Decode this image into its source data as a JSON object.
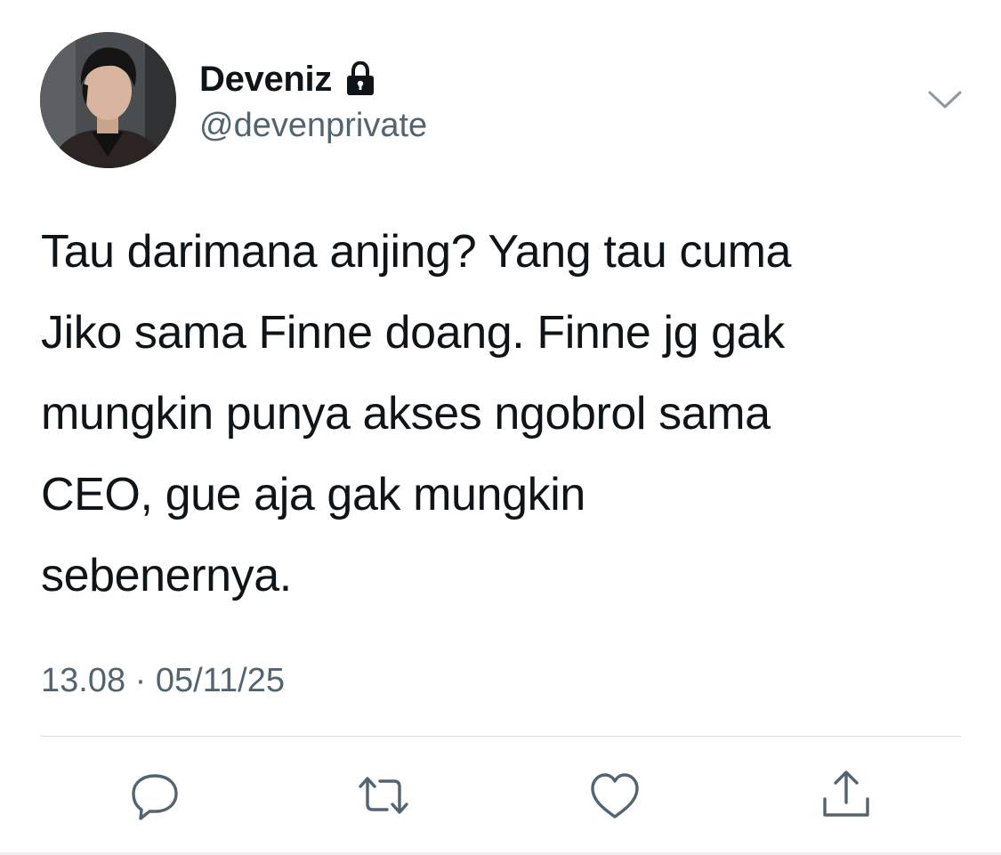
{
  "user": {
    "display_name": "Deveniz",
    "handle": "@devenprivate",
    "protected_icon": "lock-icon",
    "avatar_icon": "avatar-photo"
  },
  "tweet": {
    "text_lines": [
      "Tau darimana anjing? Yang tau cuma",
      "Jiko sama Finne doang. Finne jg gak",
      "mungkin punya akses ngobrol sama",
      "CEO, gue aja gak mungkin",
      "sebenernya."
    ],
    "timestamp": "13.08 · 05/11/25"
  },
  "actions": {
    "more_icon": "chevron-down-icon",
    "reply_icon": "reply-bubble-icon",
    "retweet_icon": "retweet-icon",
    "like_icon": "heart-icon",
    "share_icon": "share-upload-icon"
  },
  "colors": {
    "text_primary": "#0f1419",
    "text_secondary": "#536471",
    "icon": "#536471",
    "divider": "#d9dee2"
  }
}
